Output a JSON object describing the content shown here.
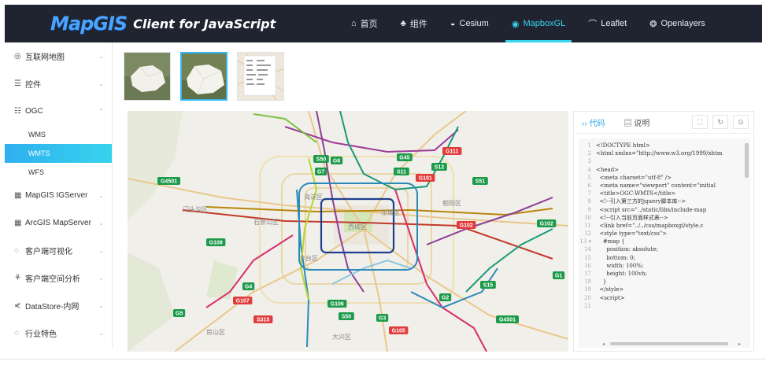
{
  "header": {
    "logo_mark": "MapGIS",
    "logo_text": "Client for JavaScript",
    "nav": [
      {
        "icon": "⌂",
        "label": "首页"
      },
      {
        "icon": "♣",
        "label": "组件"
      },
      {
        "icon": "◒",
        "label": "Cesium"
      },
      {
        "icon": "◉",
        "label": "MapboxGL"
      },
      {
        "icon": "⌒",
        "label": "Leaflet"
      },
      {
        "icon": "❂",
        "label": "Openlayers"
      }
    ]
  },
  "sidebar": {
    "items": [
      {
        "icon": "◎",
        "label": "互联网地图",
        "arrow": "⌄"
      },
      {
        "icon": "☰",
        "label": "控件",
        "arrow": "⌄"
      },
      {
        "icon": "☷",
        "label": "OGC",
        "arrow": "⌃"
      },
      {
        "icon": "▦",
        "label": "MapGIS IGServer",
        "arrow": "⌄"
      },
      {
        "icon": "▦",
        "label": "ArcGIS MapServer",
        "arrow": "⌄"
      },
      {
        "icon": "◌",
        "label": "客户端可视化",
        "arrow": "⌄"
      },
      {
        "icon": "⚘",
        "label": "客户端空间分析",
        "arrow": "⌄"
      },
      {
        "icon": "⋞",
        "label": "DataStore-内网",
        "arrow": "⌄"
      },
      {
        "icon": "◌",
        "label": "行业特色",
        "arrow": "⌄"
      }
    ],
    "ogc_sub": [
      "WMS",
      "WMTS",
      "WFS"
    ]
  },
  "code_panel": {
    "tab_code": "代码",
    "tab_code_icon": "‹›",
    "tab_desc": "说明",
    "tab_desc_icon": "▤",
    "tools": [
      "⛶",
      "↻",
      "⊙"
    ],
    "lines": [
      {
        "n": "1",
        "t": "<!DOCTYPE html>"
      },
      {
        "n": "2",
        "t": "<html xmlns=\"http://www.w3.org/1999/xhtm"
      },
      {
        "n": "3",
        "t": ""
      },
      {
        "n": "4",
        "t": "<head>"
      },
      {
        "n": "5",
        "t": "  <meta charset=\"utf-8\" />"
      },
      {
        "n": "6",
        "t": "  <meta name=\"viewport\" content=\"initial"
      },
      {
        "n": "7",
        "t": "  <title>OGC-WMTS</title>"
      },
      {
        "n": "8",
        "t": "  <!--引入第三方的jquery脚本库-->"
      },
      {
        "n": "9",
        "t": "  <script src=\"../static/libs/include-map"
      },
      {
        "n": "10",
        "t": "  <!--引入当前页面样式表-->"
      },
      {
        "n": "11",
        "t": "  <link href=\"../../css/mapboxgl/style.c"
      },
      {
        "n": "12",
        "t": "  <style type=\"text/css\">"
      },
      {
        "n": "13 ▾",
        "t": "    #map {"
      },
      {
        "n": "14",
        "t": "      position: absolute;"
      },
      {
        "n": "15",
        "t": "      bottom: 0;"
      },
      {
        "n": "16",
        "t": "      width: 100%;"
      },
      {
        "n": "17",
        "t": "      height: 100vh;"
      },
      {
        "n": "18",
        "t": "    }"
      },
      {
        "n": "19",
        "t": "  </style>"
      },
      {
        "n": "20",
        "t": "  <script>"
      },
      {
        "n": "21",
        "t": ""
      }
    ]
  },
  "map": {
    "districts": [
      "海淀区",
      "石景山区",
      "东城区",
      "西城区",
      "丰台区",
      "朝阳区",
      "大兴区",
      "房山区",
      "门头沟区"
    ],
    "road_badges": [
      {
        "label": "G4501",
        "color": "#1c9a4a"
      },
      {
        "label": "S50",
        "color": "#1c9a4a"
      },
      {
        "label": "G6",
        "color": "#1c9a4a"
      },
      {
        "label": "G7",
        "color": "#1c9a4a"
      },
      {
        "label": "G45",
        "color": "#1c9a4a"
      },
      {
        "label": "S11",
        "color": "#1c9a4a"
      },
      {
        "label": "G111",
        "color": "#e23b3b"
      },
      {
        "label": "S12",
        "color": "#1c9a4a"
      },
      {
        "label": "G101",
        "color": "#e23b3b"
      },
      {
        "label": "S51",
        "color": "#1c9a4a"
      },
      {
        "label": "G102",
        "color": "#e23b3b"
      },
      {
        "label": "G102",
        "color": "#1c9a4a"
      },
      {
        "label": "G108",
        "color": "#1c9a4a"
      },
      {
        "label": "G4",
        "color": "#1c9a4a"
      },
      {
        "label": "G107",
        "color": "#e23b3b"
      },
      {
        "label": "G5",
        "color": "#1c9a4a"
      },
      {
        "label": "S315",
        "color": "#e23b3b"
      },
      {
        "label": "G106",
        "color": "#1c9a4a"
      },
      {
        "label": "S50",
        "color": "#1c9a4a"
      },
      {
        "label": "G3",
        "color": "#1c9a4a"
      },
      {
        "label": "G105",
        "color": "#e23b3b"
      },
      {
        "label": "S15",
        "color": "#1c9a4a"
      },
      {
        "label": "G2",
        "color": "#1c9a4a"
      },
      {
        "label": "G4501",
        "color": "#1c9a4a"
      },
      {
        "label": "G1",
        "color": "#1c9a4a"
      }
    ]
  }
}
